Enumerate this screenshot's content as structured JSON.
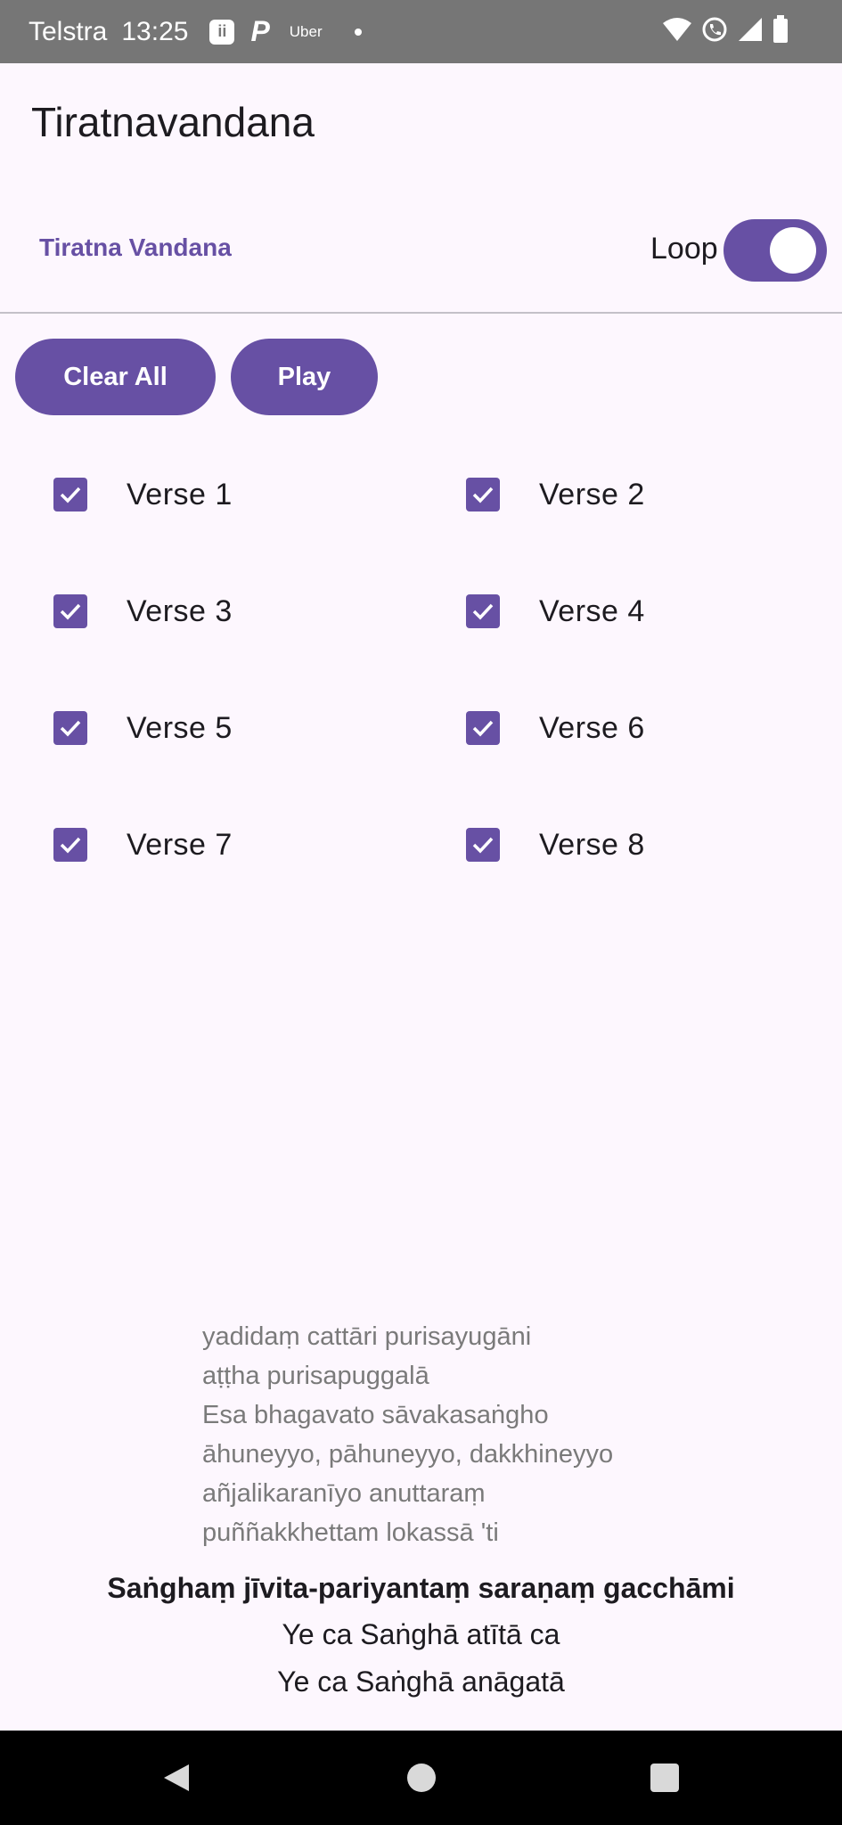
{
  "status_bar": {
    "carrier": "Telstra",
    "time": "13:25",
    "notif_icon_letter": "ii",
    "p_icon": "P",
    "uber_label": "Uber",
    "icons": [
      "wifi-icon",
      "call-icon",
      "signal-icon",
      "battery-icon"
    ]
  },
  "app_bar": {
    "title": "Tiratnavandana"
  },
  "tabs": {
    "active_label": "Tiratna Vandana"
  },
  "loop": {
    "label": "Loop",
    "enabled": true
  },
  "actions": {
    "clear_label": "Clear All",
    "play_label": "Play"
  },
  "verses": [
    {
      "label": "Verse 1",
      "checked": true
    },
    {
      "label": "Verse 2",
      "checked": true
    },
    {
      "label": "Verse 3",
      "checked": true
    },
    {
      "label": "Verse 4",
      "checked": true
    },
    {
      "label": "Verse 5",
      "checked": true
    },
    {
      "label": "Verse 6",
      "checked": true
    },
    {
      "label": "Verse 7",
      "checked": true
    },
    {
      "label": "Verse 8",
      "checked": true
    }
  ],
  "text": {
    "lines": [
      "yadidaṃ cattāri purisayugāni",
      "aṭṭha purisapuggalā",
      "Esa bhagavato sāvakasaṅgho",
      "āhuneyyo, pāhuneyyo, dakkhineyyo",
      "añjalikaranīyo anuttaraṃ",
      "puññakkhettam lokassā 'ti"
    ],
    "refrain_bold": "Saṅghaṃ jīvita-pariyantaṃ saraṇaṃ gacchāmi",
    "refrain_1": "Ye ca Saṅghā atītā ca",
    "refrain_2": "Ye ca Saṅghā anāgatā"
  },
  "colors": {
    "accent": "#6750a4",
    "background": "#fdf7fe",
    "status_bar": "#767676",
    "secondary_text": "#7a7a7a"
  }
}
